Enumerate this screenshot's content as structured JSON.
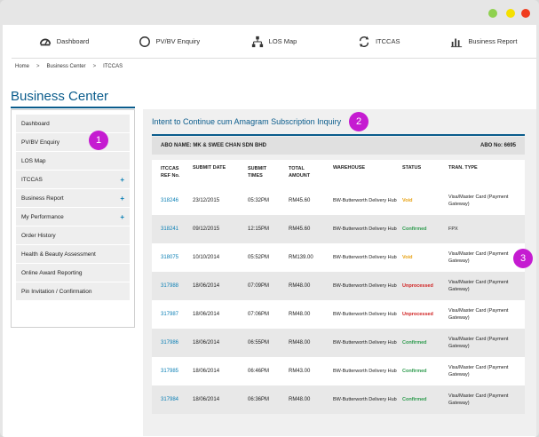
{
  "colors": {
    "accent": "#0a5c8c",
    "link": "#0a7fb5",
    "callout": "#c51bd1",
    "void": "#e8a317",
    "confirmed": "#2e9b4e",
    "unprocessed": "#d01f1f"
  },
  "nav": [
    {
      "label": "Dashboard",
      "icon": "dashboard-icon"
    },
    {
      "label": "PV/BV Enquiry",
      "icon": "circle-icon"
    },
    {
      "label": "LOS Map",
      "icon": "org-chart-icon"
    },
    {
      "label": "ITCCAS",
      "icon": "refresh-icon"
    },
    {
      "label": "Business Report",
      "icon": "bar-chart-icon"
    }
  ],
  "breadcrumb": [
    "Home",
    "Business Center",
    "ITCCAS"
  ],
  "breadcrumb_sep": ">",
  "section_title": "Business Center",
  "sidebar": [
    {
      "label": "Dashboard",
      "expand": ""
    },
    {
      "label": "PV/BV Enquiry",
      "expand": ""
    },
    {
      "label": "LOS Map",
      "expand": ""
    },
    {
      "label": "ITCCAS",
      "expand": "+"
    },
    {
      "label": "Business Report",
      "expand": "+"
    },
    {
      "label": "My Performance",
      "expand": "+"
    },
    {
      "label": "Order History",
      "expand": ""
    },
    {
      "label": "Health & Beauty Assessment",
      "expand": ""
    },
    {
      "label": "Online Award Reporting",
      "expand": ""
    },
    {
      "label": "Pin Invitation / Confirmation",
      "expand": ""
    }
  ],
  "inquiry": {
    "title": "Intent to Continue cum Amagram Subscription Inquiry",
    "abo_name": "ABO NAME: MK & SWEE CHAN SDN BHD",
    "abo_no": "ABO No: 6695"
  },
  "table": {
    "headers": [
      "ITCCAS\nREF No.",
      "SUBMIT DATE",
      "SUBMIT\nTIMES",
      "TOTAL\nAMOUNT",
      "WAREHOUSE",
      "STATUS",
      "TRAN. TYPE"
    ],
    "rows": [
      {
        "ref": "318246",
        "date": "23/12/2015",
        "time": "05:32PM",
        "amount": "RM45.60",
        "warehouse": "BW-Butterworth Delivery Hub",
        "status": "Void",
        "tran": "Visa/Master Card (Payment Gateway)"
      },
      {
        "ref": "318241",
        "date": "09/12/2015",
        "time": "12:15PM",
        "amount": "RM45.60",
        "warehouse": "BW-Butterworth Delivery Hub",
        "status": "Confirmed",
        "tran": "FPX"
      },
      {
        "ref": "318075",
        "date": "10/10/2014",
        "time": "05:52PM",
        "amount": "RM139.00",
        "warehouse": "BW-Butterworth Delivery Hub",
        "status": "Void",
        "tran": "Visa/Master Card (Payment Gateway)"
      },
      {
        "ref": "317988",
        "date": "18/06/2014",
        "time": "07:09PM",
        "amount": "RM48.00",
        "warehouse": "BW-Butterworth Delivery Hub",
        "status": "Unprocessed",
        "tran": "Visa/Master Card (Payment Gateway)"
      },
      {
        "ref": "317987",
        "date": "18/06/2014",
        "time": "07:06PM",
        "amount": "RM48.00",
        "warehouse": "BW-Butterworth Delivery Hub",
        "status": "Unprocessed",
        "tran": "Visa/Master Card (Payment Gateway)"
      },
      {
        "ref": "317986",
        "date": "18/06/2014",
        "time": "06:55PM",
        "amount": "RM48.00",
        "warehouse": "BW-Butterworth Delivery Hub",
        "status": "Confirmed",
        "tran": "Visa/Master Card (Payment Gateway)"
      },
      {
        "ref": "317985",
        "date": "18/06/2014",
        "time": "06:46PM",
        "amount": "RM43.00",
        "warehouse": "BW-Butterworth Delivery Hub",
        "status": "Confirmed",
        "tran": "Visa/Master Card (Payment Gateway)"
      },
      {
        "ref": "317984",
        "date": "18/06/2014",
        "time": "06:36PM",
        "amount": "RM48.00",
        "warehouse": "BW-Butterworth Delivery Hub",
        "status": "Confirmed",
        "tran": "Visa/Master Card (Payment Gateway)"
      }
    ]
  },
  "callouts": [
    "1",
    "2",
    "3"
  ]
}
